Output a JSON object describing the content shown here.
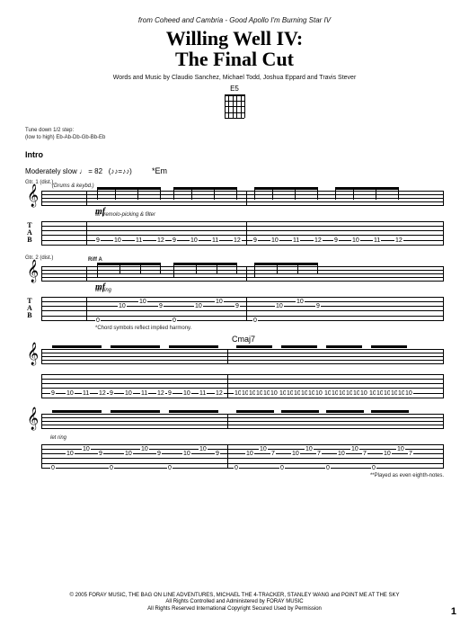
{
  "source": {
    "prefix": "from ",
    "artist": "Coheed and Cambria",
    "sep": " - ",
    "album": "Good Apollo I'm Burning Star IV"
  },
  "title": {
    "line1": "Willing Well IV:",
    "line2": "The Final Cut"
  },
  "credits": "Words and Music by Claudio Sanchez, Michael Todd, Joshua Eppard and Travis Stever",
  "chord": {
    "name": "E5"
  },
  "tuning": {
    "line1": "Tune down 1/2 step:",
    "line2": "(low to high) Eb-Ab-Db-Gb-Bb-Eb"
  },
  "intro": {
    "label": "Intro",
    "tempo": "Moderately slow",
    "bpm": "♩ = 82",
    "swing": "(♪♪=♪♪)",
    "key": "*Em"
  },
  "gtr1": {
    "label": "Gtr. 1 (dist.)",
    "drums": "(Drums & keybd.)",
    "dyn": "mf",
    "note": "w/ tremolo-picking & filter"
  },
  "gtr2": {
    "label": "Gtr. 2 (dist.)",
    "riff": "Riff A",
    "dyn": "mf",
    "note": "let ring"
  },
  "footnote1": "*Chord symbols reflect implied harmony.",
  "sys2": {
    "chord": "Cmaj7",
    "note": "let ring",
    "footnote": "**Played as even eighth-notes."
  },
  "tab_gtr1_sys1": [
    "9",
    "10",
    "11",
    "12",
    "9",
    "10",
    "11",
    "12",
    "9",
    "10",
    "11",
    "12",
    "9",
    "10",
    "11",
    "12"
  ],
  "tab_gtr2_sys1": [
    "0",
    "10",
    "10",
    "9",
    "0",
    "10",
    "10",
    "9",
    "0",
    "10",
    "10",
    "9"
  ],
  "tab_gtr1_sys2a": [
    "9",
    "10",
    "11",
    "12",
    "9",
    "10",
    "11",
    "12",
    "9",
    "10",
    "11",
    "12"
  ],
  "tab_gtr1_sys2b": [
    "10",
    "10",
    "10",
    "10",
    "10",
    "10",
    "10",
    "10",
    "10",
    "10",
    "10",
    "10",
    "10",
    "10",
    "10",
    "10",
    "10",
    "10",
    "10",
    "10",
    "10",
    "10",
    "10",
    "10"
  ],
  "tab_gtr2_sys2a": [
    "0",
    "10",
    "10",
    "9",
    "0",
    "10",
    "10",
    "9",
    "0",
    "10",
    "10",
    "9"
  ],
  "tab_gtr2_sys2b": [
    "0",
    "10",
    "10",
    "7",
    "0",
    "10",
    "10",
    "7",
    "0",
    "10",
    "10",
    "7",
    "0",
    "10",
    "10",
    "7"
  ],
  "copyright": {
    "line1": "© 2005 FORAY MUSIC, THE BAG ON LINE ADVENTURES, MICHAEL THE 4-TRACKER, STANLEY WANG and POINT ME AT THE SKY",
    "line2": "All Rights Controlled and Administered by FORAY MUSIC",
    "line3": "All Rights Reserved   International Copyright Secured   Used by Permission"
  },
  "page_number": "1"
}
